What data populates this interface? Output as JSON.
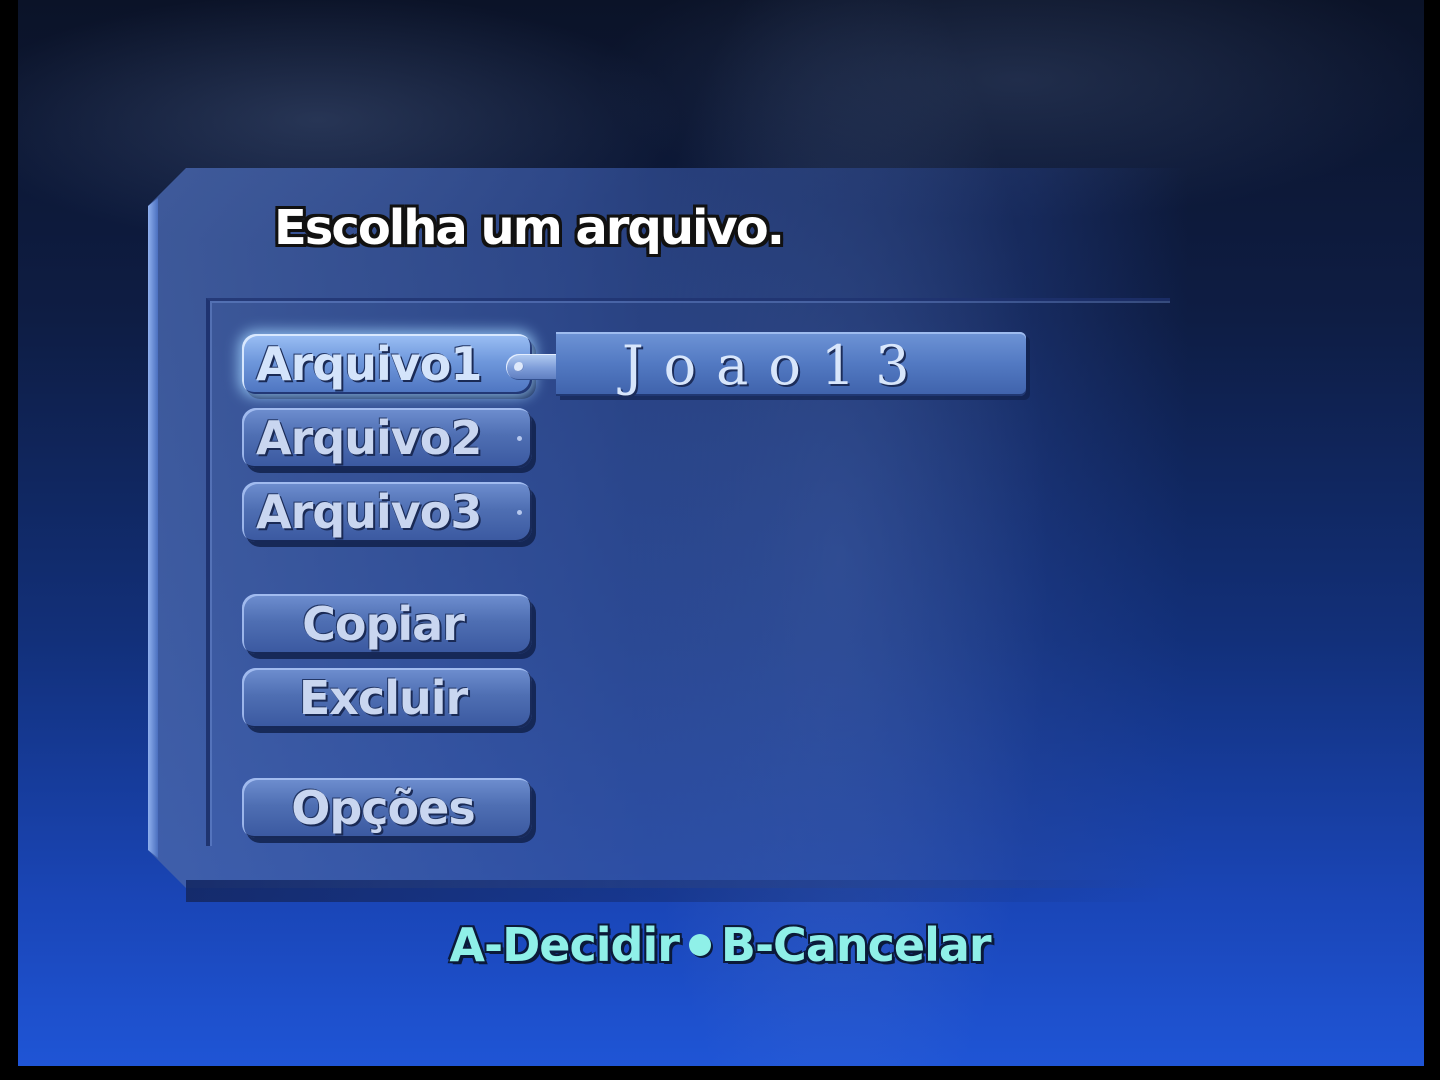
{
  "dialog": {
    "title": "Escolha um arquivo."
  },
  "files": [
    {
      "label": "Arquivo1",
      "player_name": "Joao13"
    },
    {
      "label": "Arquivo2"
    },
    {
      "label": "Arquivo3"
    }
  ],
  "actions": {
    "copy_label": "Copiar",
    "delete_label": "Excluir",
    "options_label": "Opções"
  },
  "controls_hint": {
    "confirm": "A-Decidir",
    "cancel": "B-Cancelar"
  },
  "colors": {
    "panel": "#4f6fb3",
    "selected_glow": "#a0d2ff",
    "hint_text": "#8ff0e8",
    "background_bottom": "#1f55d6"
  }
}
